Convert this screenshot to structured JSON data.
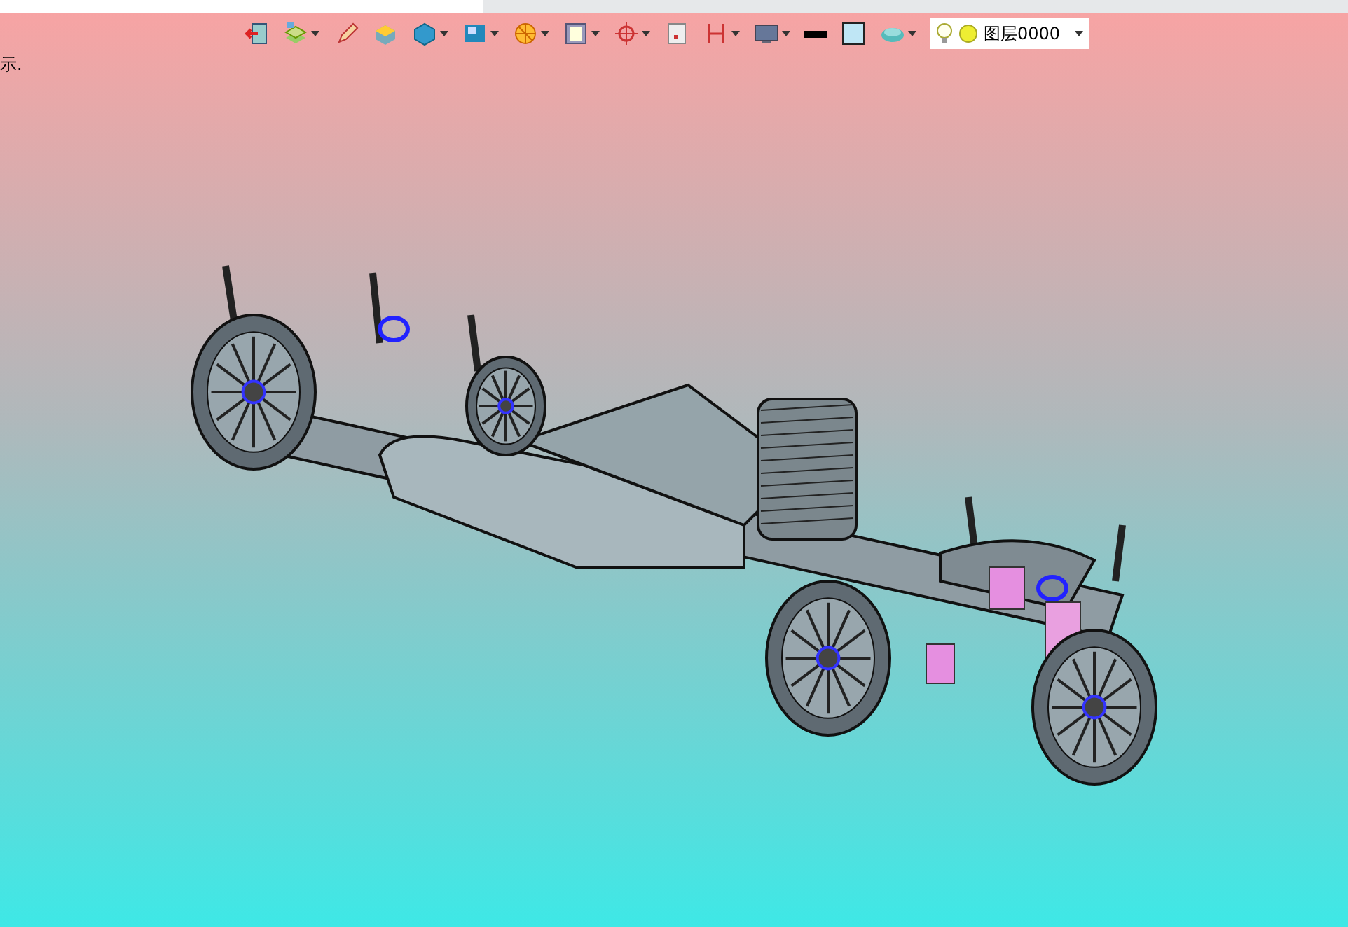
{
  "toolbar": [
    {
      "kind": "exit",
      "menu": false
    },
    {
      "kind": "layers",
      "menu": true
    },
    {
      "kind": "pen",
      "menu": false
    },
    {
      "kind": "cube-top",
      "menu": false
    },
    {
      "kind": "cube",
      "menu": true
    },
    {
      "kind": "view",
      "menu": true
    },
    {
      "kind": "sphere",
      "menu": true
    },
    {
      "kind": "page",
      "menu": true
    },
    {
      "kind": "target",
      "menu": true
    },
    {
      "kind": "sheet",
      "menu": false
    },
    {
      "kind": "dimension",
      "menu": true
    },
    {
      "kind": "monitor",
      "menu": true
    },
    {
      "kind": "line",
      "menu": false
    },
    {
      "kind": "fill",
      "menu": false
    },
    {
      "kind": "stack",
      "menu": true
    }
  ],
  "layer_selector": {
    "name": "图层0000"
  },
  "hint": "示."
}
